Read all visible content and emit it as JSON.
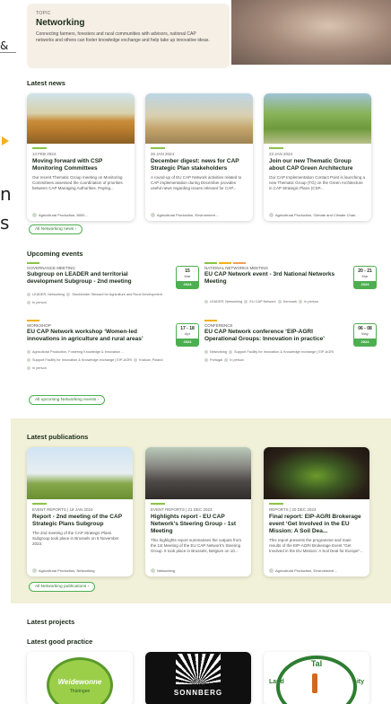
{
  "left_edge": {
    "fragment_1": "&",
    "fragment_2": "n",
    "fragment_3": "s"
  },
  "hero": {
    "topic_label": "TOPIC",
    "title": "Networking",
    "description": "Connecting farmers, foresters and rural communities with advisors, national CAP networks and others can foster knowledge exchange and help take up innovative ideas."
  },
  "latest_news": {
    "heading": "Latest news",
    "items": [
      {
        "date": "14 FEB 2024",
        "title": "Moving forward with CSP Monitoring Committees",
        "desc": "Our recent Thematic Group meeting on Monitoring Committees assessed the coordination of priorities between CAP Managing Authorities. Paying...",
        "tag": "Agricultural Production, 8000..."
      },
      {
        "date": "26 JAN 2024",
        "title": "December digest: news for CAP Strategic Plan stakeholders",
        "desc": "A round-up of EU CAP Network activities related to CAP implementation during December provides useful news regarding issues relevant for CAP...",
        "tag": "Agricultural Production, Environment ..."
      },
      {
        "date": "23 JAN 2024",
        "title": "Join our new Thematic Group about CAP Green Architecture",
        "desc": "Our CAP Implementation Contact Point is launching a new Thematic Group (TG) on the Green Architecture in CAP Strategic Plans (CSP...",
        "tag": "Agricultural Production, Climate and Climate Chan..."
      }
    ],
    "all_link": "All Networking news"
  },
  "upcoming_events": {
    "heading": "Upcoming events",
    "items": [
      {
        "category": "GOVERNANCE MEETING",
        "title": "Subgroup on LEADER and territorial development Subgroup - 2nd meeting",
        "day": "15",
        "month": "Mar",
        "year": "2024",
        "tags_1": "LEADER, Networking",
        "tags_2": "Stockholder Steward for Agriculture and Rural Development",
        "tags_3": "In person",
        "bar_colors": [
          "#8bc34a"
        ]
      },
      {
        "category": "NATIONAL NETWORKS MEETING",
        "title": "EU CAP Network event - 3rd National Networks Meeting",
        "day": "20 - 21",
        "month": "Mar",
        "year": "2024",
        "tags_1": "LEADER, Networking",
        "tags_2": "EU CAP Network",
        "tags_3": "Denmark",
        "tags_4": "In person",
        "bar_colors": [
          "#8bc34a",
          "#f2b21a",
          "#f29e57"
        ]
      },
      {
        "category": "WORKSHOP",
        "title": "EU CAP Network workshop ‘Women-led innovations in agriculture and rural areas’",
        "day": "17 - 18",
        "month": "Apr",
        "year": "2024",
        "tags_1": "Agricultural Production, Fostering Knowledge & Innovation ...",
        "tags_2": "Support Facility for Innovation & Knowledge exchange | EIP-AGRI",
        "tags_3": "Krakow, Poland",
        "tags_4": "In person",
        "bar_colors": [
          "#f2b21a"
        ]
      },
      {
        "category": "CONFERENCE",
        "title": "EU CAP Network conference ‘EIP-AGRI Operational Groups: Innovation in practice’",
        "day": "06 - 08",
        "month": "May",
        "year": "2024",
        "tags_1": "Networking",
        "tags_2": "Support Facility for Innovation & Knowledge exchange | EIP-AGRI",
        "tags_3": "Portugal",
        "tags_4": "In person",
        "bar_colors": [
          "#f2b21a"
        ]
      }
    ],
    "all_link": "All upcoming Networking events"
  },
  "latest_publications": {
    "heading": "Latest publications",
    "items": [
      {
        "meta": "EVENT REPORTS | 18 JAN 2024",
        "title": "Report - 2nd meeting of the CAP Strategic Plans Subgroup",
        "desc": "The 2nd meeting of the CAP Strategic Plans Subgroup took place in Brussels on 8 November 2023.",
        "tag": "Agricultural Production, Networking"
      },
      {
        "meta": "EVENT REPORTS | 21 DEC 2023",
        "title": "Highlights report - EU CAP Network's Steering Group - 1st Meeting",
        "desc": "This highlights report summarises the outputs from the 1st Meeting of the EU CAP Network's Steering Group. It took place in Brussels, Belgium on 10...",
        "tag": "Networking"
      },
      {
        "meta": "REPORTS | 20 DEC 2023",
        "title": "Final report: EIP-AGRI Brokerage event ‘Get Involved in the EU Mission: A Soil Dea...",
        "desc": "This report presents the programme and main results of the EIP-AGRI Brokerage Event “Get Involved in the EU Mission: A Soil Deal for Europe”...",
        "tag": "Agricultural Production, Environment ..."
      }
    ],
    "all_link": "All Networking publications"
  },
  "latest_projects": {
    "heading": "Latest projects"
  },
  "latest_good_practice": {
    "heading": "Latest good practice",
    "logos": [
      {
        "name": "Weidewonne",
        "sub": "Thüringen"
      },
      {
        "name": "SONNBERG"
      },
      {
        "name": "Tal",
        "side_left": "Land",
        "side_right": "nity"
      }
    ]
  },
  "colors": {
    "accent_green": "#4caf50",
    "accent_lime": "#8bc34a",
    "accent_yellow": "#f2b21a",
    "publication_bg": "#f1f0d8"
  }
}
